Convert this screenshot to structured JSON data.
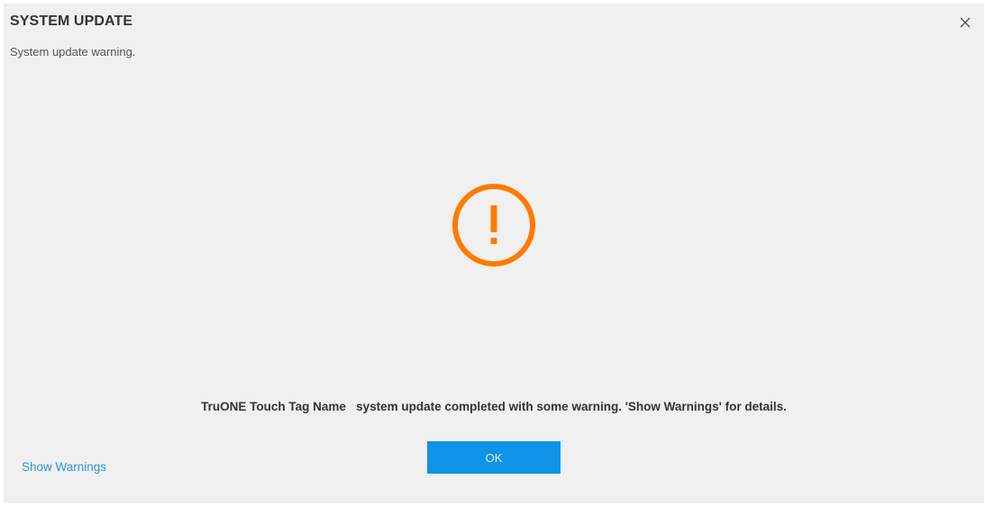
{
  "dialog": {
    "title": "SYSTEM UPDATE",
    "subtitle": "System update warning.",
    "close_icon": "close-icon",
    "status_icon": "warning-circle-icon",
    "status_color": "#ff7a00",
    "message": "TruONE Touch Tag Name   system update completed with some warning. 'Show Warnings' for details.",
    "ok_label": "OK",
    "show_warnings_label": "Show Warnings",
    "accent_color": "#0f93e8",
    "background_color": "#f0f0f0"
  }
}
